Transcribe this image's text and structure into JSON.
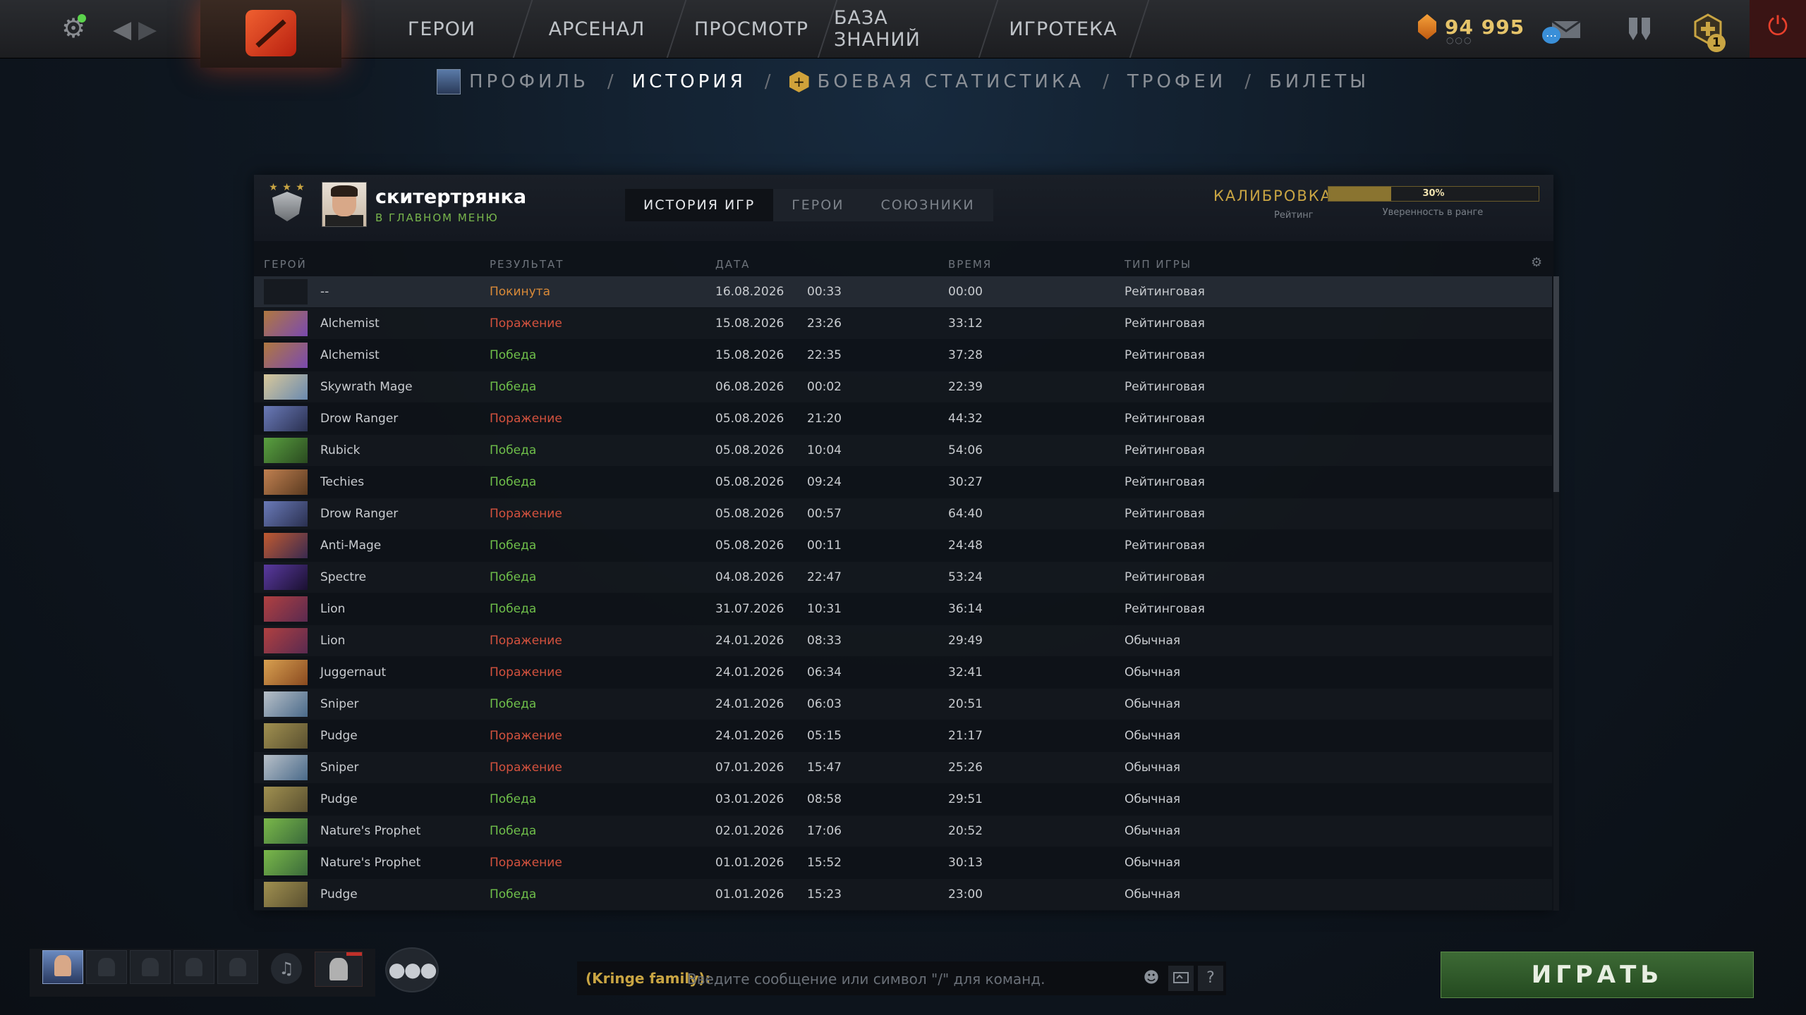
{
  "top_nav": {
    "items": [
      "ГЕРОИ",
      "АРСЕНАЛ",
      "ПРОСМОТР",
      "БАЗА ЗНАНИЙ",
      "ИГРОТЕКА"
    ],
    "gold": "94 995",
    "gold_dots": "○○○",
    "notification_count": "1",
    "chat_icon_glyph": "…"
  },
  "sub_nav": {
    "profile": "ПРОФИЛЬ",
    "history": "ИСТОРИЯ",
    "battle_stats": "БОЕВАЯ СТАТИСТИКА",
    "trophies": "ТРОФЕИ",
    "tickets": "БИЛЕТЫ",
    "separator": "/",
    "hex_glyph": "+"
  },
  "profile": {
    "name": "скитертрянка",
    "status": "В ГЛАВНОМ МЕНЮ",
    "medal_stars": "★ ★ ★"
  },
  "tabs": [
    "ИСТОРИЯ ИГР",
    "ГЕРОИ",
    "СОЮЗНИКИ"
  ],
  "calibration": {
    "label": "КАЛИБРОВКА",
    "rating_label": "Рейтинг",
    "confidence_percent": 30,
    "confidence_text": "30%",
    "confidence_label": "Уверенность в ранге",
    "bar_color": "#8a7430"
  },
  "table": {
    "headers": [
      "ГЕРОЙ",
      "РЕЗУЛЬТАТ",
      "ДАТА",
      "ВРЕМЯ",
      "ТИП ИГРЫ"
    ],
    "settings_glyph": "⚙",
    "rows": [
      {
        "hero": "--",
        "result": "Покинута",
        "status": "aband",
        "date": "16.08.2026",
        "time": "00:33",
        "duration": "00:00",
        "type": "Рейтинговая"
      },
      {
        "hero": "Alchemist",
        "result": "Поражение",
        "status": "loss",
        "date": "15.08.2026",
        "time": "23:26",
        "duration": "33:12",
        "type": "Рейтинговая"
      },
      {
        "hero": "Alchemist",
        "result": "Победа",
        "status": "win",
        "date": "15.08.2026",
        "time": "22:35",
        "duration": "37:28",
        "type": "Рейтинговая"
      },
      {
        "hero": "Skywrath Mage",
        "result": "Победа",
        "status": "win",
        "date": "06.08.2026",
        "time": "00:02",
        "duration": "22:39",
        "type": "Рейтинговая"
      },
      {
        "hero": "Drow Ranger",
        "result": "Поражение",
        "status": "loss",
        "date": "05.08.2026",
        "time": "21:20",
        "duration": "44:32",
        "type": "Рейтинговая"
      },
      {
        "hero": "Rubick",
        "result": "Победа",
        "status": "win",
        "date": "05.08.2026",
        "time": "10:04",
        "duration": "54:06",
        "type": "Рейтинговая"
      },
      {
        "hero": "Techies",
        "result": "Победа",
        "status": "win",
        "date": "05.08.2026",
        "time": "09:24",
        "duration": "30:27",
        "type": "Рейтинговая"
      },
      {
        "hero": "Drow Ranger",
        "result": "Поражение",
        "status": "loss",
        "date": "05.08.2026",
        "time": "00:57",
        "duration": "64:40",
        "type": "Рейтинговая"
      },
      {
        "hero": "Anti-Mage",
        "result": "Победа",
        "status": "win",
        "date": "05.08.2026",
        "time": "00:11",
        "duration": "24:48",
        "type": "Рейтинговая"
      },
      {
        "hero": "Spectre",
        "result": "Победа",
        "status": "win",
        "date": "04.08.2026",
        "time": "22:47",
        "duration": "53:24",
        "type": "Рейтинговая"
      },
      {
        "hero": "Lion",
        "result": "Победа",
        "status": "win",
        "date": "31.07.2026",
        "time": "10:31",
        "duration": "36:14",
        "type": "Рейтинговая"
      },
      {
        "hero": "Lion",
        "result": "Поражение",
        "status": "loss",
        "date": "24.01.2026",
        "time": "08:33",
        "duration": "29:49",
        "type": "Обычная"
      },
      {
        "hero": "Juggernaut",
        "result": "Поражение",
        "status": "loss",
        "date": "24.01.2026",
        "time": "06:34",
        "duration": "32:41",
        "type": "Обычная"
      },
      {
        "hero": "Sniper",
        "result": "Победа",
        "status": "win",
        "date": "24.01.2026",
        "time": "06:03",
        "duration": "20:51",
        "type": "Обычная"
      },
      {
        "hero": "Pudge",
        "result": "Поражение",
        "status": "loss",
        "date": "24.01.2026",
        "time": "05:15",
        "duration": "21:17",
        "type": "Обычная"
      },
      {
        "hero": "Sniper",
        "result": "Поражение",
        "status": "loss",
        "date": "07.01.2026",
        "time": "15:47",
        "duration": "25:26",
        "type": "Обычная"
      },
      {
        "hero": "Pudge",
        "result": "Победа",
        "status": "win",
        "date": "03.01.2026",
        "time": "08:58",
        "duration": "29:51",
        "type": "Обычная"
      },
      {
        "hero": "Nature's Prophet",
        "result": "Победа",
        "status": "win",
        "date": "02.01.2026",
        "time": "17:06",
        "duration": "20:52",
        "type": "Обычная"
      },
      {
        "hero": "Nature's Prophet",
        "result": "Поражение",
        "status": "loss",
        "date": "01.01.2026",
        "time": "15:52",
        "duration": "30:13",
        "type": "Обычная"
      },
      {
        "hero": "Pudge",
        "result": "Победа",
        "status": "win",
        "date": "01.01.2026",
        "time": "15:23",
        "duration": "23:00",
        "type": "Обычная"
      }
    ]
  },
  "hero_colors": {
    "--": [
      "#161a20",
      "#161a20"
    ],
    "Alchemist": [
      "#b07840",
      "#7a4ab0"
    ],
    "Skywrath Mage": [
      "#d8c89a",
      "#6a8ab0"
    ],
    "Drow Ranger": [
      "#6a7ab8",
      "#2a3050"
    ],
    "Rubick": [
      "#5aa040",
      "#2a4a20"
    ],
    "Techies": [
      "#c08050",
      "#5a3a20"
    ],
    "Anti-Mage": [
      "#c05a30",
      "#3a2a50"
    ],
    "Spectre": [
      "#5a3aa0",
      "#1a1030"
    ],
    "Lion": [
      "#b04040",
      "#5a2a50"
    ],
    "Juggernaut": [
      "#d8a050",
      "#8a4a20"
    ],
    "Sniper": [
      "#b8c0c8",
      "#4a6a8a"
    ],
    "Pudge": [
      "#a09050",
      "#5a5030"
    ],
    "Nature's Prophet": [
      "#7ab84a",
      "#3a6a3a"
    ]
  },
  "bottom": {
    "channel": "(Kringe family):",
    "chat_placeholder": "Введите сообщение или символ \"/\" для команд.",
    "help_glyph": "?",
    "emoji_glyph": "☻",
    "team_glyph": "●●●",
    "voice_glyph": "♫",
    "play_label": "ИГРАТЬ"
  }
}
